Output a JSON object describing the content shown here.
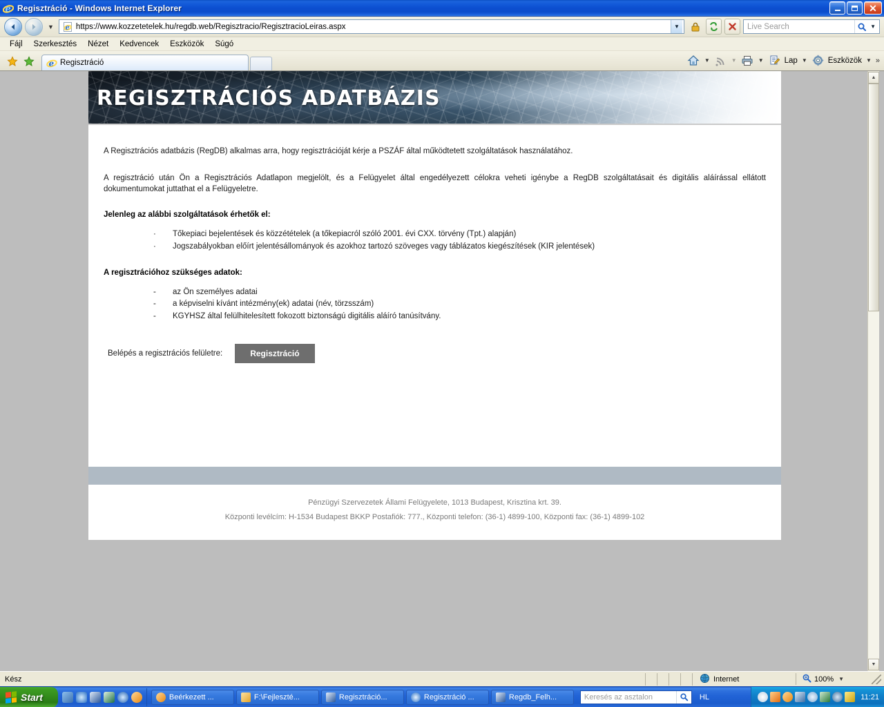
{
  "window": {
    "title": "Regisztráció - Windows Internet Explorer",
    "app_icon": "ie-logo-icon",
    "minimize_label": "",
    "maximize_label": "",
    "close_label": "✕"
  },
  "address_bar": {
    "back_label": "◄",
    "forward_label": "►",
    "history_caret": "▼",
    "url": "https://www.kozzetetelek.hu/regdb.web/Regisztracio/RegisztracioLeiras.aspx",
    "url_dropdown_caret": "▼",
    "icons": [
      "lock-icon",
      "refresh-icon",
      "stop-icon"
    ],
    "search_placeholder": "Live Search",
    "search_caret": "▼"
  },
  "menu": {
    "items": [
      "Fájl",
      "Szerkesztés",
      "Nézet",
      "Kedvencek",
      "Eszközök",
      "Súgó"
    ]
  },
  "tabbar": {
    "favorites_icon": "star-icon",
    "add_favorites_icon": "add-star-icon",
    "tab_label": "Regisztráció",
    "tab_icon": "ie-page-icon",
    "new_tab_label": "",
    "right_items": [
      {
        "icon": "home-icon",
        "label": "",
        "caret": "▼"
      },
      {
        "icon": "rss-icon",
        "label": "",
        "caret": "▼"
      },
      {
        "icon": "print-icon",
        "label": "",
        "caret": "▼"
      },
      {
        "icon": "page-icon",
        "label": "Lap",
        "caret": "▼"
      },
      {
        "icon": "gear-icon",
        "label": "Eszközök",
        "caret": "▼"
      }
    ],
    "overflow": "»"
  },
  "page": {
    "banner_title": "REGISZTRÁCIÓS ADATBÁZIS",
    "paragraphs": [
      "A Regisztrációs adatbázis (RegDB) alkalmas arra, hogy regisztrációját kérje a PSZÁF által működtetett szolgáltatások használatához.",
      "A regisztráció után Ön a Regisztrációs Adatlapon megjelölt, és a Felügyelet által engedélyezett célokra veheti igénybe a RegDB szolgáltatásait és digitális aláírással ellátott dokumentumokat juttathat el a Felügyeletre."
    ],
    "services_heading": "Jelenleg az alábbi szolgáltatások érhetők el:",
    "services_bullet": "·",
    "services": [
      "Tőkepiaci bejelentések és közzétételek (a tőkepiacról szóló 2001. évi CXX. törvény (Tpt.) alapján)",
      "Jogszabályokban előírt jelentésállományok és azokhoz tartozó szöveges vagy táblázatos kiegészítések (KIR jelentések)"
    ],
    "required_heading": "A regisztrációhoz szükséges adatok:",
    "required_bullet": "-",
    "required": [
      "az Ön személyes adatai",
      "a képviselni kívánt intézmény(ek) adatai (név, törzsszám)",
      "KGYHSZ által felülhitelesített fokozott biztonságú digitális aláíró tanúsítvány."
    ],
    "cta_label": "Belépés a regisztrációs felületre:",
    "cta_button": "Regisztráció",
    "footer_lines": [
      "Pénzügyi Szervezetek Állami Felügyelete, 1013 Budapest, Krisztina krt. 39.",
      "Központi levélcím: H-1534 Budapest BKKP Postafiók: 777., Központi telefon: (36-1) 4899-100, Központi fax: (36-1) 4899-102"
    ]
  },
  "scrollbar": {
    "up_arrow": "▲",
    "down_arrow": "▼"
  },
  "status_bar": {
    "status": "Kész",
    "zone_icon": "globe-icon",
    "zone": "Internet",
    "zoom_icon": "zoom-icon",
    "zoom": "100%",
    "zoom_caret": "▼"
  },
  "taskbar": {
    "start_label": "Start",
    "quick_launch": [
      "show-desktop-icon",
      "internet-explorer-icon",
      "word-icon",
      "excel-icon",
      "media-player-icon",
      "outlook-icon"
    ],
    "tasks": [
      {
        "icon": "outlook-icon",
        "label": "Beérkezett ..."
      },
      {
        "icon": "folder-icon",
        "label": "F:\\Fejleszté..."
      },
      {
        "icon": "word-icon",
        "label": "Regisztráció..."
      },
      {
        "icon": "ie-icon",
        "label": "Regisztráció ..."
      },
      {
        "icon": "word-icon",
        "label": "Regdb_Felh..."
      }
    ],
    "desktop_search_placeholder": "Keresés az asztalon",
    "desktop_search_icon": "search-icon",
    "language": "HL",
    "tray_icons": [
      "cd-icon",
      "safely-remove-icon",
      "outlook-tray-icon",
      "norton-icon",
      "magnifier-icon",
      "network-icon",
      "volume-icon",
      "shield-icon"
    ],
    "clock": "11:21"
  },
  "colors": {
    "title_bar": "#0c4fd0",
    "page_background": "#bdbdbd",
    "footer_band": "#afbac4",
    "cta_button": "#6e6e6e",
    "taskbar": "#2163d6",
    "start_button": "#338c1b"
  }
}
